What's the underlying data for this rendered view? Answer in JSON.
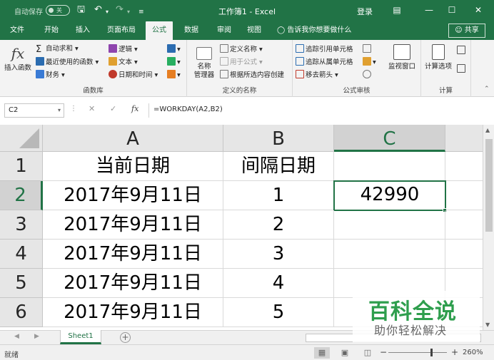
{
  "titlebar": {
    "autosave_label": "自动保存",
    "autosave_state": "关",
    "title": "工作簿1 - Excel",
    "login": "登录"
  },
  "tabs": [
    "文件",
    "开始",
    "插入",
    "页面布局",
    "公式",
    "数据",
    "审阅",
    "视图"
  ],
  "active_tab": "公式",
  "tell_me": "告诉我你想要做什么",
  "share": "共享",
  "ribbon": {
    "insert_function": "插入函数",
    "autosum": "自动求和",
    "recent": "最近使用的函数",
    "financial": "财务",
    "logical": "逻辑",
    "text": "文本",
    "datetime": "日期和时间",
    "group_library": "函数库",
    "name_manager_1": "名称",
    "name_manager_2": "管理器",
    "define_name": "定义名称",
    "use_in_formula": "用于公式",
    "create_from_selection": "根据所选内容创建",
    "group_names": "定义的名称",
    "trace_precedents": "追踪引用单元格",
    "trace_dependents": "追踪从属单元格",
    "remove_arrows": "移去箭头",
    "watch_window": "监视窗口",
    "group_audit": "公式审核",
    "calc_options": "计算选项",
    "group_calc": "计算"
  },
  "formula_bar": {
    "name_box": "C2",
    "fx": "fx",
    "formula": "=WORKDAY(A2,B2)"
  },
  "sheet": {
    "columns": [
      "A",
      "B",
      "C"
    ],
    "rows": [
      "1",
      "2",
      "3",
      "4",
      "5",
      "6"
    ],
    "cells": [
      [
        "当前日期",
        "间隔日期",
        ""
      ],
      [
        "2017年9月11日",
        "1",
        "42990"
      ],
      [
        "2017年9月11日",
        "2",
        ""
      ],
      [
        "2017年9月11日",
        "3",
        ""
      ],
      [
        "2017年9月11日",
        "4",
        ""
      ],
      [
        "2017年9月11日",
        "5",
        ""
      ]
    ],
    "active_cell": "C2"
  },
  "sheet_tab": "Sheet1",
  "status": {
    "ready": "就绪",
    "zoom": "260%"
  },
  "watermark": {
    "line1": "百科全说",
    "line2": "助你轻松解决"
  },
  "colors": {
    "accent": "#217346",
    "watermark_green": "#2e9e4d"
  }
}
